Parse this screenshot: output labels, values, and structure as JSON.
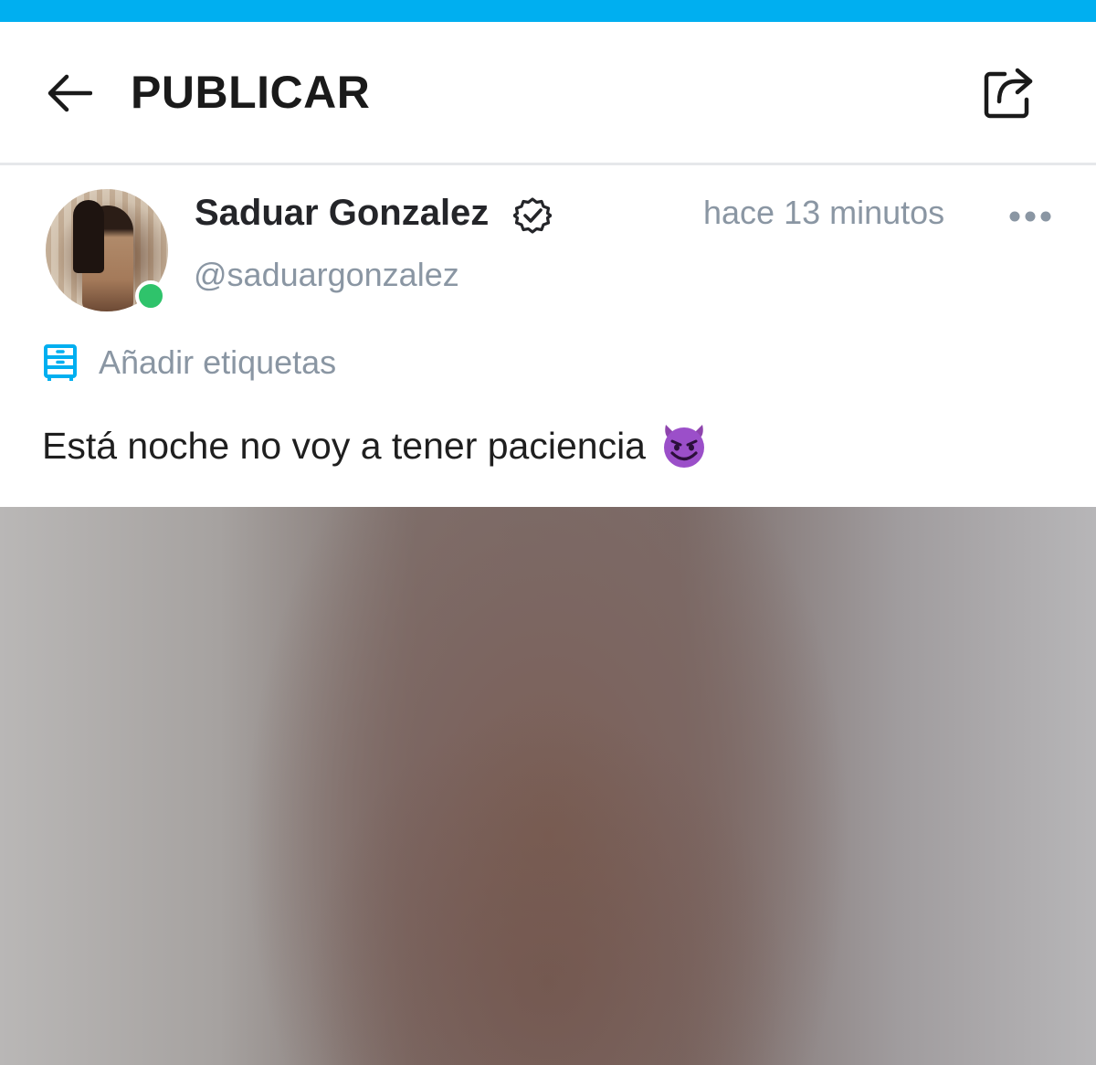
{
  "app": {
    "accent_color": "#00aff0",
    "online_color": "#2fc36b"
  },
  "header": {
    "back_icon": "arrow-left-icon",
    "title": "PUBLICAR",
    "share_icon": "share-icon"
  },
  "post": {
    "author": {
      "display_name": "Saduar Gonzalez",
      "verified_icon": "verified-badge-icon",
      "username": "@saduargonzalez",
      "online": true
    },
    "timestamp": "hace 13 minutos",
    "more_icon": "more-horizontal-icon",
    "tags": {
      "icon": "tag-list-icon",
      "label": "Añadir etiquetas"
    },
    "text": "Está noche no voy a tener paciencia",
    "emoji": "smiling-devil-emoji"
  }
}
